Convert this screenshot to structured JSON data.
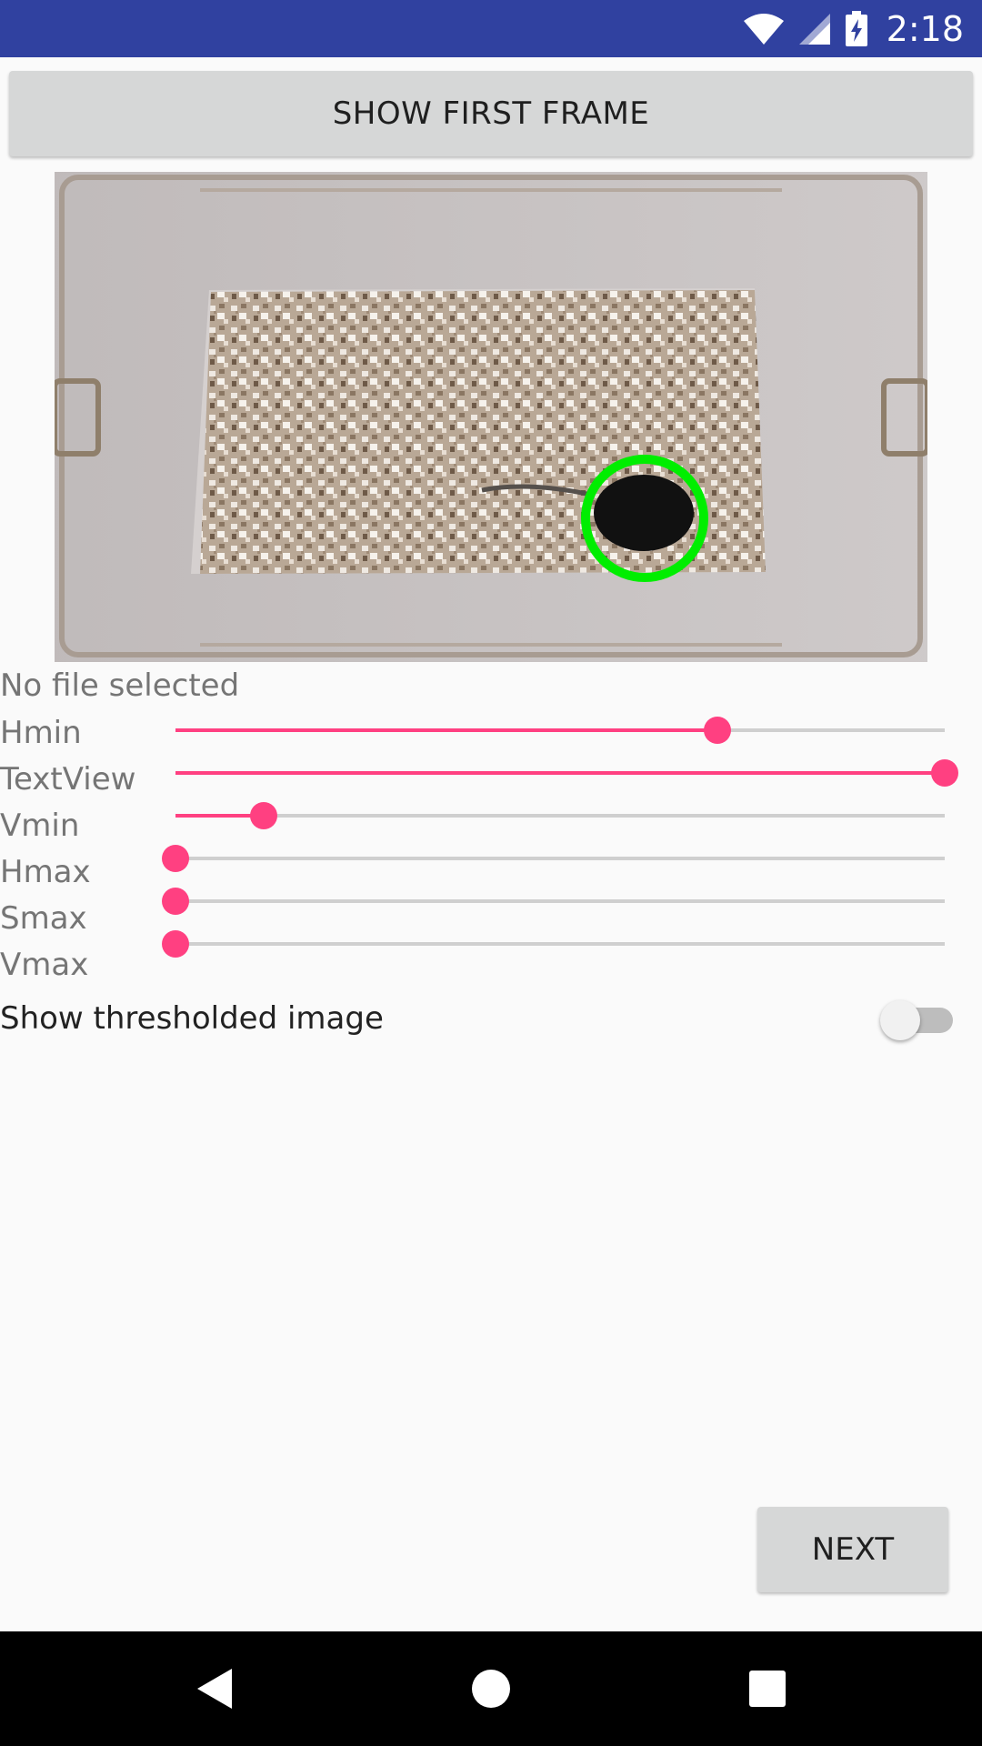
{
  "status_bar": {
    "time": "2:18",
    "icons": [
      "wifi-icon",
      "signal-icon",
      "battery-charging-icon"
    ]
  },
  "top_button": {
    "label": "SHOW FIRST FRAME"
  },
  "camera_frame": {
    "description_icon": "video-frame",
    "marker_color": "#00ee00"
  },
  "file_status": "No file selected",
  "sliders": [
    {
      "label": "Hmin",
      "value": 0.705
    },
    {
      "label": "TextView",
      "value": 1.0
    },
    {
      "label": "Vmin",
      "value": 0.115
    },
    {
      "label": "Hmax",
      "value": 0.0
    },
    {
      "label": "Smax",
      "value": 0.0
    },
    {
      "label": "Vmax",
      "value": 0.0
    }
  ],
  "threshold_switch": {
    "label": "Show thresholded image",
    "checked": false
  },
  "next_button": {
    "label": "NEXT"
  },
  "nav_bar": {
    "icons": [
      "back-icon",
      "home-icon",
      "recents-icon"
    ]
  },
  "colors": {
    "accent": "#ff4081",
    "status_bar": "#3041a0"
  }
}
